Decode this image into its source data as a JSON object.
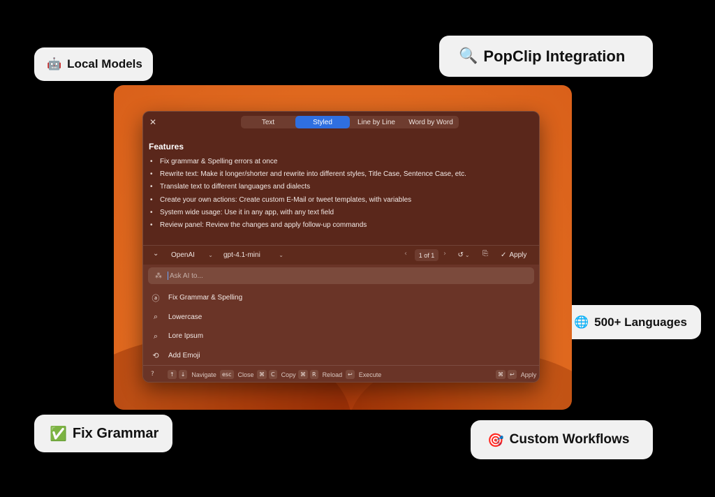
{
  "badges": {
    "local_models": {
      "emoji": "🤖",
      "label": "Local Models"
    },
    "popclip": {
      "emoji": "🔍",
      "label": "PopClip Integration"
    },
    "languages": {
      "emoji": "🌐",
      "label": "500+ Languages"
    },
    "fix_grammar": {
      "emoji": "✅",
      "label": "Fix Grammar"
    },
    "custom_workflows": {
      "emoji": "🎯",
      "label": "Custom Workflows"
    }
  },
  "window": {
    "close_glyph": "✕",
    "tabs": [
      {
        "label": "Text"
      },
      {
        "label": "Styled"
      },
      {
        "label": "Line by Line"
      },
      {
        "label": "Word by Word"
      }
    ],
    "active_tab": "Styled",
    "document": {
      "title": "Features",
      "bullets": [
        "Fix grammar & Spelling errors at once",
        "Rewrite text: Make it longer/shorter and rewrite into different styles, Title Case, Sentence Case, etc.",
        "Translate text to different languages and dialects",
        "Create your own actions: Create custom E-Mail or tweet templates, with variables",
        "System wide usage: Use it in any app, with any text field",
        "Review panel: Review the changes and apply follow-up commands"
      ]
    },
    "toolbar": {
      "collapse_glyph": "⌄",
      "provider": "OpenAI",
      "model": "gpt-4.1-mini",
      "prev_glyph": "‹",
      "page": "1 of 1",
      "next_glyph": "›",
      "history_glyph": "↺",
      "copy_glyph": "⎘",
      "apply_label": "Apply"
    },
    "ask": {
      "placeholder": "Ask AI to..."
    },
    "actions": [
      {
        "icon": "ⓐ",
        "icon_name": "grammar-icon",
        "label": "Fix Grammar & Spelling"
      },
      {
        "icon": "⌕",
        "icon_name": "lowercase-icon",
        "label": "Lowercase"
      },
      {
        "icon": "⌕",
        "icon_name": "lorem-icon",
        "label": "Lore Ipsum"
      },
      {
        "icon": "⟲",
        "icon_name": "emoji-icon",
        "label": "Add Emoji"
      }
    ],
    "statusbar": {
      "help_glyph": "?",
      "navigate": {
        "keys": [
          "↑",
          "↓"
        ],
        "label": "Navigate"
      },
      "close": {
        "keys": [
          "esc"
        ],
        "label": "Close"
      },
      "copy": {
        "keys": [
          "⌘",
          "C"
        ],
        "label": "Copy"
      },
      "reload": {
        "keys": [
          "⌘",
          "R"
        ],
        "label": "Reload"
      },
      "execute": {
        "keys": [
          "↩"
        ],
        "label": "Execute"
      },
      "apply": {
        "keys": [
          "⌘",
          "↩"
        ],
        "label": "Apply"
      }
    }
  },
  "colors": {
    "accent": "#2f6fe0",
    "window_bg": "#5a271b",
    "desktop_orange": "#e0691f"
  }
}
